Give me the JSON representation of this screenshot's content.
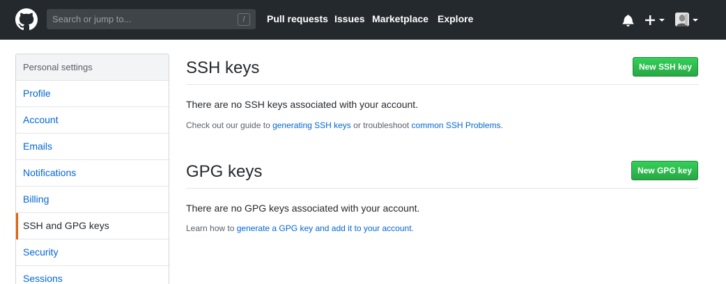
{
  "header": {
    "search_placeholder": "Search or jump to...",
    "search_shortcut": "/",
    "nav": {
      "pull_requests": "Pull requests",
      "issues": "Issues",
      "marketplace": "Marketplace",
      "explore": "Explore"
    },
    "plus_symbol": "+",
    "background_color": "#24292e"
  },
  "sidebar": {
    "heading": "Personal settings",
    "items": [
      {
        "label": "Profile"
      },
      {
        "label": "Account"
      },
      {
        "label": "Emails"
      },
      {
        "label": "Notifications"
      },
      {
        "label": "Billing"
      },
      {
        "label": "SSH and GPG keys",
        "selected": true
      },
      {
        "label": "Security"
      },
      {
        "label": "Sessions"
      }
    ],
    "selected_accent": "#e36209",
    "link_color": "#0366d6"
  },
  "ssh": {
    "title": "SSH keys",
    "new_button": "New SSH key",
    "empty_message": "There are no SSH keys associated with your account.",
    "note_prefix": "Check out our guide to ",
    "note_link1": "generating SSH keys",
    "note_middle": " or troubleshoot ",
    "note_link2": "common SSH Problems",
    "note_suffix": "."
  },
  "gpg": {
    "title": "GPG keys",
    "new_button": "New GPG key",
    "empty_message": "There are no GPG keys associated with your account.",
    "note_prefix": "Learn how to ",
    "note_link": "generate a GPG key and add it to your account",
    "note_suffix": "."
  },
  "colors": {
    "primary_button": "#28a745",
    "link": "#0366d6"
  },
  "icons": [
    "github-logo-icon",
    "bell-icon",
    "plus-icon",
    "chevron-down-icon",
    "avatar"
  ]
}
